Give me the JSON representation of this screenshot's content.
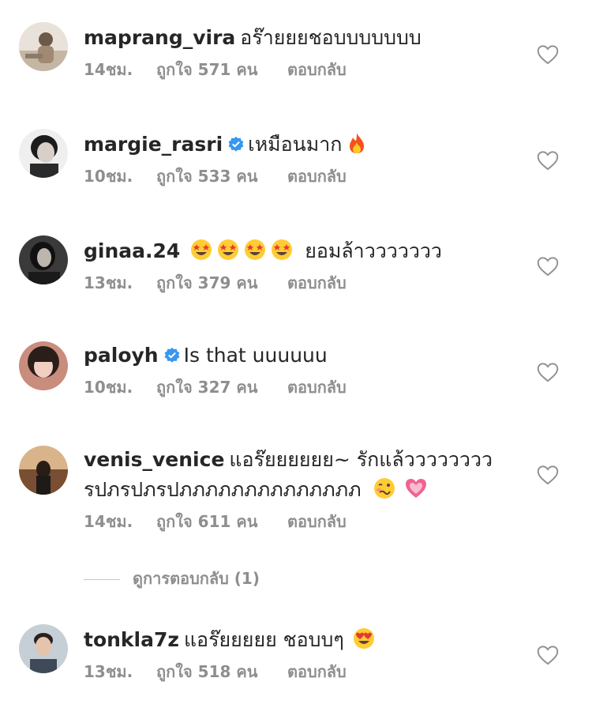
{
  "comments": [
    {
      "username": "maprang_vira",
      "verified": false,
      "text": "อร๊ายยยชอบบบบบบบ",
      "emojis": [],
      "time": "14ชม.",
      "likes_prefix": "ถูกใจ",
      "likes": "571",
      "likes_suffix": "คน",
      "reply": "ตอบกลับ",
      "avatar_color": "#c9b9a6"
    },
    {
      "username": "margie_rasri",
      "verified": true,
      "text": "เหมือนมาก",
      "emojis": [
        "fire"
      ],
      "time": "10ชม.",
      "likes_prefix": "ถูกใจ",
      "likes": "533",
      "likes_suffix": "คน",
      "reply": "ตอบกลับ",
      "avatar_color": "#d9d9d9"
    },
    {
      "username": "ginaa.24",
      "verified": false,
      "text": "ยอมล้าววววววว",
      "emojis_before": [
        "star-struck",
        "star-struck",
        "star-struck",
        "star-struck"
      ],
      "time": "13ชม.",
      "likes_prefix": "ถูกใจ",
      "likes": "379",
      "likes_suffix": "คน",
      "reply": "ตอบกลับ",
      "avatar_color": "#2b2b2b"
    },
    {
      "username": "paloyh",
      "verified": true,
      "text": "Is that uuuuuu",
      "emojis": [],
      "time": "10ชม.",
      "likes_prefix": "ถูกใจ",
      "likes": "327",
      "likes_suffix": "คน",
      "reply": "ตอบกลับ",
      "avatar_color": "#e3b9ad"
    },
    {
      "username": "venis_venice",
      "verified": false,
      "text": "แอร๊ยยยยยย~ รักแล้วววววววว",
      "text2": "รปภรปภรปภภภภภภภภภภภภภภ",
      "emojis": [
        "woozy",
        "pink-heart"
      ],
      "time": "14ชม.",
      "likes_prefix": "ถูกใจ",
      "likes": "611",
      "likes_suffix": "คน",
      "reply": "ตอบกลับ",
      "avatar_color": "#8a6a4f"
    },
    {
      "username": "tonkla7z",
      "verified": false,
      "text": "แอร๊ยยยยย ชอบบๆ",
      "emojis": [
        "heart-eyes"
      ],
      "time": "13ชม.",
      "likes_prefix": "ถูกใจ",
      "likes": "518",
      "likes_suffix": "คน",
      "reply": "ตอบกลับ",
      "avatar_color": "#b9c3cc"
    }
  ],
  "view_replies": {
    "label": "ดูการตอบกลับ (1)"
  },
  "colors": {
    "meta": "#8e8e8e",
    "verified": "#3897f0",
    "text": "#262626"
  }
}
